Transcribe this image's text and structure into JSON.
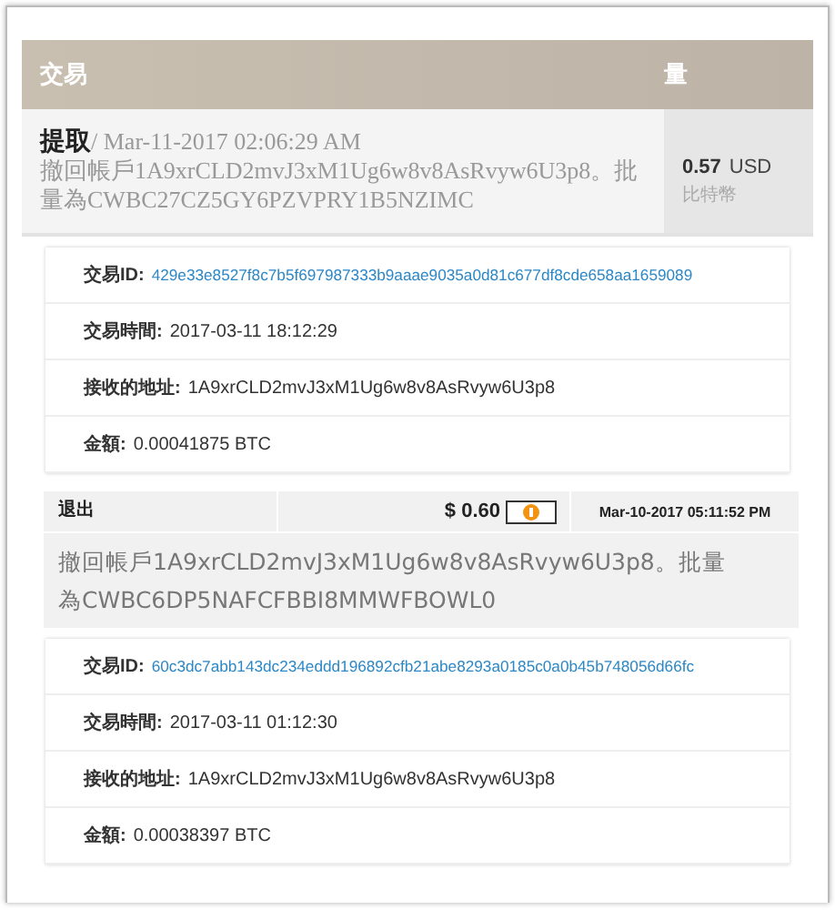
{
  "header": {
    "columns": [
      "交易",
      "量"
    ]
  },
  "transactions": [
    {
      "kind": "card",
      "type": "提取",
      "time": "/ Mar-11-2017 02:06:29 AM",
      "description": "撤回帳戶1A9xrCLD2mvJ3xM1Ug6w8v8AsRvyw6U3p8。批量為CWBC27CZ5GY6PZVPRY1B5NZIMC",
      "amount": "0.57",
      "currency": "USD",
      "unit": "比特幣",
      "details": [
        {
          "kind": "link",
          "label": "交易ID:",
          "value": "429e33e8527f8c7b5f697987333b9aaae9035a0d81c677df8cde658aa1659089"
        },
        {
          "kind": "text",
          "label": "交易時間:",
          "value": "2017-03-11 18:12:29"
        },
        {
          "kind": "text",
          "label": "接收的地址:",
          "value": "1A9xrCLD2mvJ3xM1Ug6w8v8AsRvyw6U3p8"
        },
        {
          "kind": "text",
          "label": "金額:",
          "value": "0.00041875 BTC"
        }
      ]
    },
    {
      "kind": "strip",
      "type": "退出",
      "amount": "$ 0.60",
      "date": "Mar-10-2017 05:11:52 PM",
      "description": "撤回帳戶1A9xrCLD2mvJ3xM1Ug6w8v8AsRvyw6U3p8。批量為CWBC6DP5NAFCFBBI8MMWFBOWL0",
      "details": [
        {
          "kind": "link",
          "label": "交易ID:",
          "value": "60c3dc7abb143dc234eddd196892cfb21abe8293a0185c0a0b45b748056d66fc"
        },
        {
          "kind": "text",
          "label": "交易時間:",
          "value": "2017-03-11 01:12:30"
        },
        {
          "kind": "text",
          "label": "接收的地址:",
          "value": "1A9xrCLD2mvJ3xM1Ug6w8v8AsRvyw6U3p8"
        },
        {
          "kind": "text",
          "label": "金額:",
          "value": "0.00038397 BTC"
        }
      ]
    }
  ]
}
